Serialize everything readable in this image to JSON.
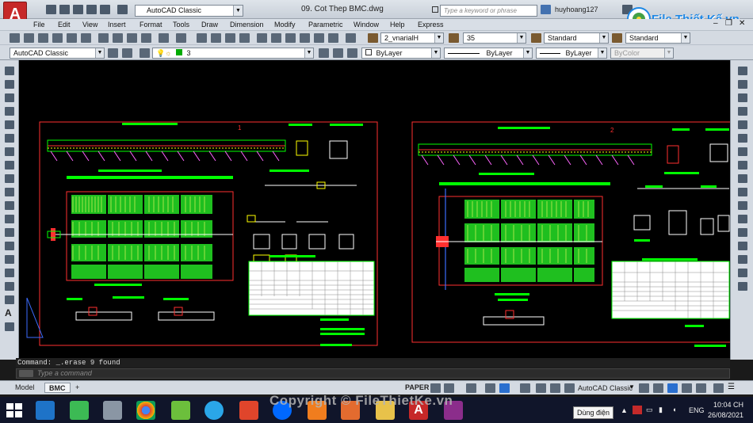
{
  "app": {
    "workspace": "AutoCAD Classic",
    "doc_title": "09. Cot Thep BMC.dwg",
    "search_placeholder": "Type a keyword or phrase",
    "user": "huyhoang127"
  },
  "menu": [
    "File",
    "Edit",
    "View",
    "Insert",
    "Format",
    "Tools",
    "Draw",
    "Dimension",
    "Modify",
    "Parametric",
    "Window",
    "Help",
    "Express"
  ],
  "toolbar": {
    "text_style": "2_vnarialH",
    "text_height": "35",
    "dim_style": "Standard",
    "table_style": "Standard",
    "workspace2": "AutoCAD Classic",
    "layer": "3",
    "color": "ByLayer",
    "linetype": "ByLayer",
    "lineweight": "ByLayer",
    "plotstyle": "ByColor"
  },
  "command": {
    "history": "Command: _.erase 9 found",
    "placeholder": "Type a command"
  },
  "layout_tabs": [
    "Model",
    "BMC",
    "+"
  ],
  "status": {
    "space": "PAPER",
    "workspace": "AutoCAD Classic"
  },
  "drawing": {
    "sheet1_number": "1",
    "sheet2_number": "2"
  },
  "watermark": {
    "brand": "File Thiết Kế.vn",
    "copyright": "Copyright © FileThietKe.vn"
  },
  "taskbar": {
    "tooltip": "Dùng điện",
    "lang": "ENG",
    "time": "10:04 CH",
    "date": "26/08/2021"
  },
  "colors": {
    "canvas": "#000000",
    "cad_green": "#00ff00",
    "cad_red": "#ff2020",
    "cad_blue": "#3b6dff"
  }
}
